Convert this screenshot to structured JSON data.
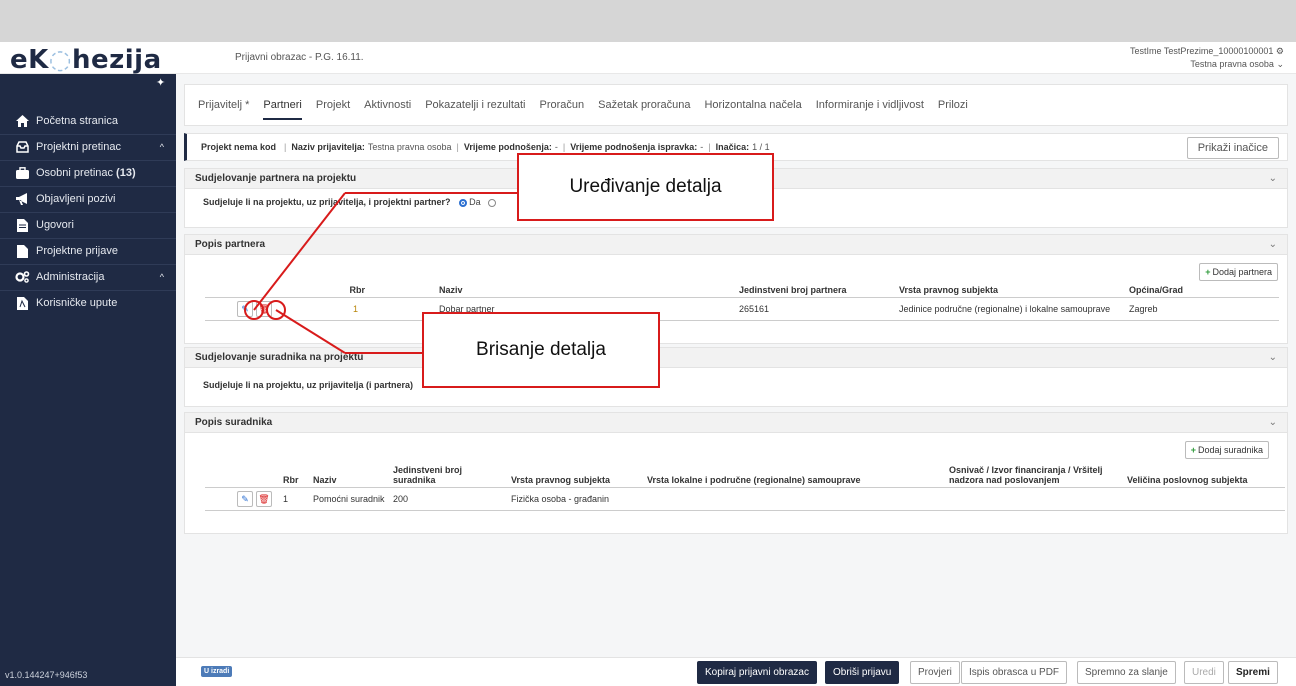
{
  "app": {
    "logo": {
      "e": "e",
      "k": "K",
      "o": "◌",
      "rest": "hezija"
    },
    "form_title": "Prijavni obrazac - P.G. 16.11.",
    "user_name": "TestIme TestPrezime_10000100001",
    "user_org": "Testna pravna osoba"
  },
  "sidebar": {
    "items": [
      {
        "label": "Početna stranica",
        "icon": "home-icon"
      },
      {
        "label": "Projektni pretinac",
        "icon": "inbox-icon",
        "caret": "^"
      },
      {
        "label": "Osobni pretinac",
        "count": "(13)",
        "icon": "briefcase-icon"
      },
      {
        "label": "Objavljeni pozivi",
        "icon": "megaphone-icon"
      },
      {
        "label": "Ugovori",
        "icon": "document-icon"
      },
      {
        "label": "Projektne prijave",
        "icon": "file-icon"
      },
      {
        "label": "Administracija",
        "icon": "cogs-icon",
        "caret": "^"
      },
      {
        "label": "Korisničke upute",
        "icon": "pdf-icon"
      }
    ],
    "version": "v1.0.144247+946f53"
  },
  "tabs": [
    "Prijavitelj *",
    "Partneri",
    "Projekt",
    "Aktivnosti",
    "Pokazatelji i rezultati",
    "Proračun",
    "Sažetak proračuna",
    "Horizontalna načela",
    "Informiranje i vidljivost",
    "Prilozi"
  ],
  "infobar": {
    "code": "Projekt nema kod",
    "applicant_label": "Naziv prijavitelja:",
    "applicant_value": "Testna pravna osoba",
    "submitted_label": "Vrijeme podnošenja:",
    "submitted_value": "-",
    "corrected_label": "Vrijeme podnošenja ispravka:",
    "corrected_value": "-",
    "version_label": "Inačica:",
    "version_value": "1 / 1",
    "show_versions": "Prikaži inačice"
  },
  "partners_participation": {
    "title": "Sudjelovanje partnera na projektu",
    "question": "Sudjeluje li na projektu, uz prijavitelja, i projektni partner?",
    "yes": "Da"
  },
  "partners_list": {
    "title": "Popis partnera",
    "add": "Dodaj partnera",
    "headers": [
      "Rbr",
      "Naziv",
      "Jedinstveni broj partnera",
      "Vrsta pravnog subjekta",
      "Općina/Grad"
    ],
    "rows": [
      [
        "1",
        "Dobar partner",
        "265161",
        "Jedinice područne (regionalne) i lokalne samouprave",
        "Zagreb"
      ]
    ]
  },
  "collab_participation": {
    "title": "Sudjelovanje suradnika na projektu",
    "question": "Sudjeluje li na projektu, uz prijavitelja (i partnera)"
  },
  "collab_list": {
    "title": "Popis suradnika",
    "add": "Dodaj suradnika",
    "headers": [
      "Rbr",
      "Naziv",
      "Jedinstveni broj suradnika",
      "Vrsta pravnog subjekta",
      "Vrsta lokalne i područne (regionalne) samouprave",
      "Osnivač / Izvor financiranja / Vršitelj nadzora nad poslovanjem",
      "Veličina poslovnog subjekta"
    ],
    "rows": [
      [
        "1",
        "Pomoćni suradnik",
        "200",
        "Fizička osoba - građanin",
        "",
        "",
        ""
      ]
    ]
  },
  "footer": {
    "badge": "U izradi",
    "buttons": [
      "Kopiraj prijavni obrazac",
      "Obriši prijavu",
      "Provjeri",
      "Ispis obrasca u PDF",
      "Spremno za slanje",
      "Uredi",
      "Spremi"
    ]
  },
  "callouts": {
    "edit": "Uređivanje detalja",
    "delete": "Brisanje detalja"
  },
  "colors": {
    "sidebar": "#1f2a44",
    "callout": "#d81b1b",
    "accent": "#2b6fd1"
  }
}
